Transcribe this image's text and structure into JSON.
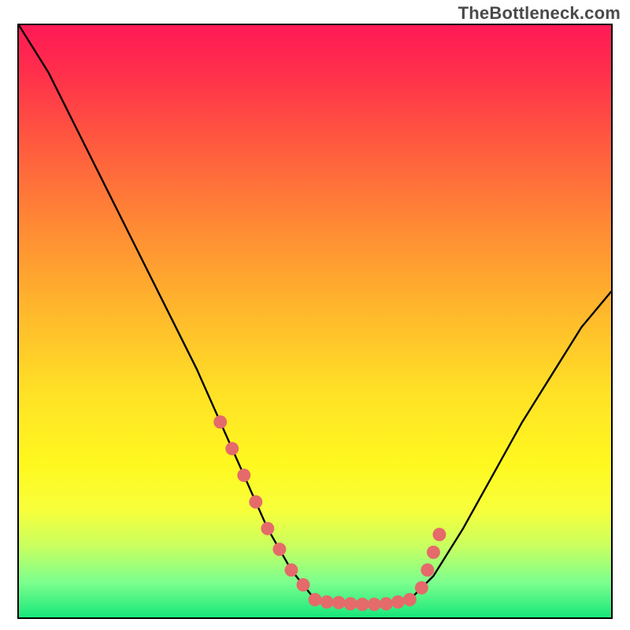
{
  "watermark": "TheBottleneck.com",
  "chart_data": {
    "type": "line",
    "title": "",
    "xlabel": "",
    "ylabel": "",
    "xlim": [
      0,
      100
    ],
    "ylim": [
      0,
      100
    ],
    "grid": false,
    "legend": false,
    "series": [
      {
        "name": "curve",
        "x": [
          0,
          5,
          10,
          15,
          20,
          25,
          30,
          34,
          38,
          42,
          46,
          50,
          54,
          58,
          62,
          66,
          70,
          75,
          80,
          85,
          90,
          95,
          100
        ],
        "y": [
          100,
          92,
          82,
          72,
          62,
          52,
          42,
          33,
          24,
          15,
          8,
          3,
          2.5,
          2.2,
          2.3,
          3,
          7,
          15,
          24,
          33,
          41,
          49,
          55
        ]
      }
    ],
    "markers": {
      "name": "highlight-points",
      "color": "#e56a6a",
      "x": [
        34,
        36,
        38,
        40,
        42,
        44,
        46,
        48,
        50,
        52,
        54,
        56,
        58,
        60,
        62,
        64,
        66,
        68,
        69,
        70,
        71
      ],
      "y": [
        33,
        28.5,
        24,
        19.5,
        15,
        11.5,
        8,
        5.5,
        3,
        2.6,
        2.5,
        2.3,
        2.2,
        2.2,
        2.3,
        2.6,
        3,
        5,
        8,
        11,
        14
      ]
    },
    "background_gradient": {
      "top": "#ff1956",
      "mid1": "#ffb72c",
      "mid2": "#fff81f",
      "bottom": "#18e77a"
    }
  }
}
